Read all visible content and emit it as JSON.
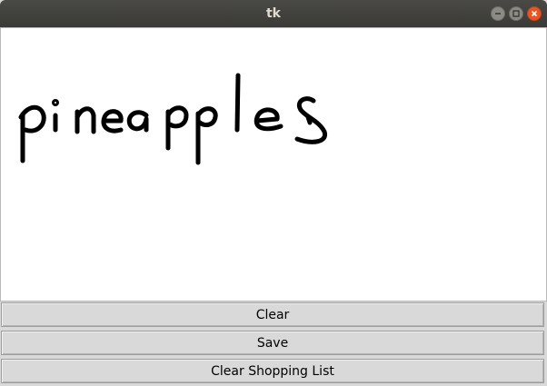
{
  "window": {
    "title": "tk"
  },
  "canvas": {
    "drawing_content": "handwritten word drawn in black ink"
  },
  "buttons": {
    "clear": "Clear",
    "save": "Save",
    "clear_shopping_list": "Clear Shopping List"
  },
  "colors": {
    "titlebar": "#3b3a36",
    "close_button": "#e95420",
    "canvas_background": "#ffffff",
    "ink": "#000000",
    "button_background": "#d9d9d9"
  }
}
